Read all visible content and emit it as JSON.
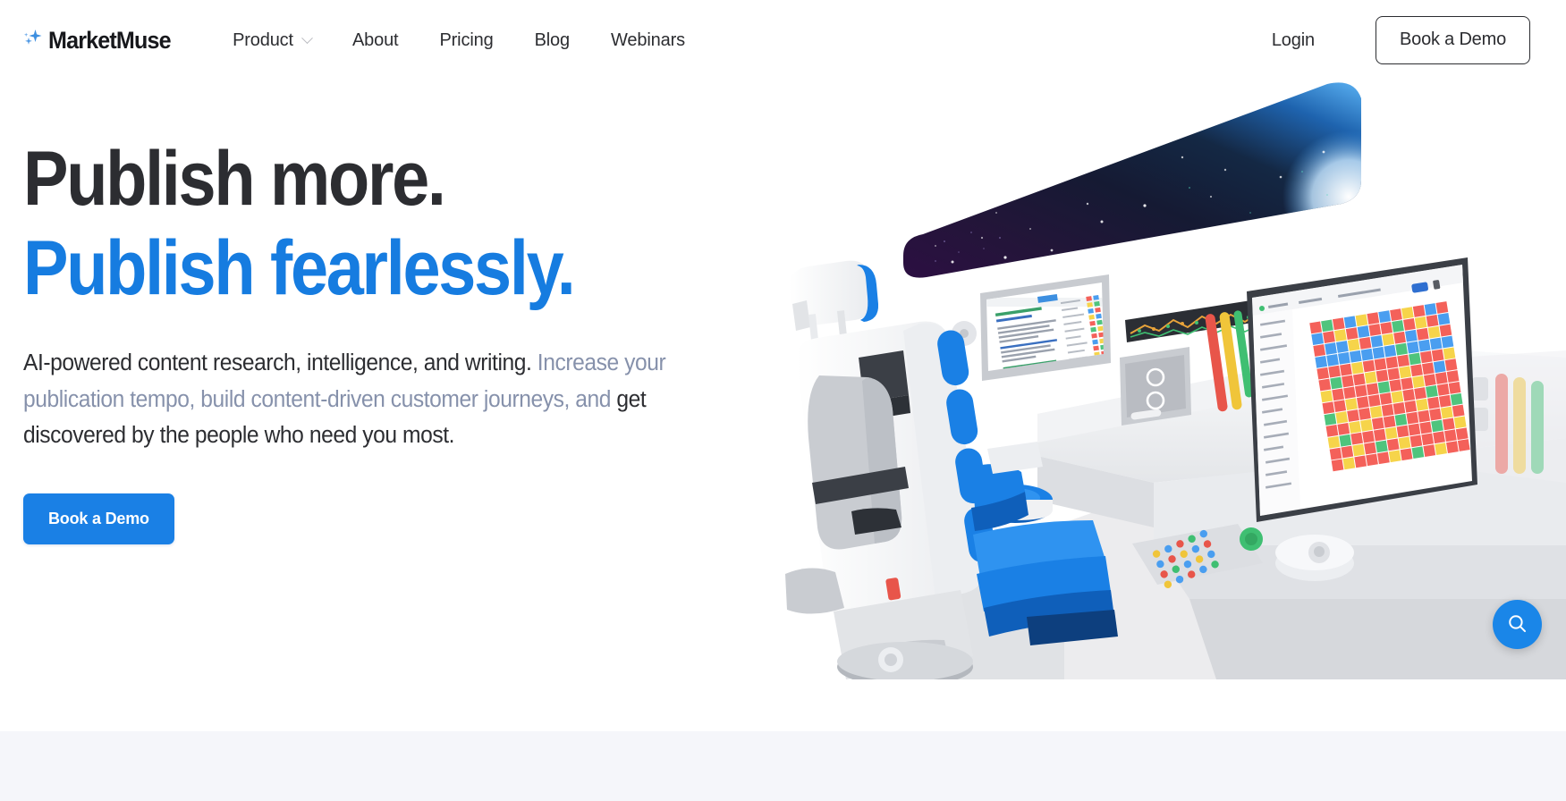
{
  "brand": {
    "name": "MarketMuse",
    "logo_icon": "sparkles-icon",
    "accent_color": "#1a80e5",
    "logo_spark_color": "#3d8fe0",
    "text_dark": "#2c2d31",
    "text_muted": "#8691ab"
  },
  "header": {
    "nav": [
      {
        "label": "Product",
        "has_dropdown": true,
        "icon": "chevron-down-icon"
      },
      {
        "label": "About",
        "has_dropdown": false
      },
      {
        "label": "Pricing",
        "has_dropdown": false
      },
      {
        "label": "Blog",
        "has_dropdown": false
      },
      {
        "label": "Webinars",
        "has_dropdown": false
      }
    ],
    "login_label": "Login",
    "demo_button_label": "Book a Demo"
  },
  "hero": {
    "headline_line1": "Publish more.",
    "headline_line2": "Publish fearlessly.",
    "subhead_part1": "AI-powered content research, intelligence, and writing. ",
    "subhead_part2": "Increase your publication tempo, build content-driven customer journeys, and",
    "subhead_part3": " get discovered by the people who need you most.",
    "cta_label": "Book a Demo"
  },
  "illustration": {
    "name": "spaceship-cockpit-illustration",
    "description": "Spaceship cockpit with captain chair, console screens and starfield viewport",
    "viewport_gradient": [
      "#2c0f42",
      "#171733",
      "#11203f",
      "#1b5fa8",
      "#4ea6f0"
    ],
    "chair_colors": [
      "#f4f5f7",
      "#1a80e5",
      "#0f5fba",
      "#c9ccd1"
    ],
    "heatmap_colors": [
      "#f4615a",
      "#f6d44a",
      "#4fc47d",
      "#4a9ef0"
    ],
    "accent_red": "#e8554a",
    "accent_yellow": "#f0c53a",
    "accent_green": "#3fbf72"
  },
  "floating": {
    "search_button_icon": "search-icon",
    "search_button_color": "#1a86e8"
  }
}
